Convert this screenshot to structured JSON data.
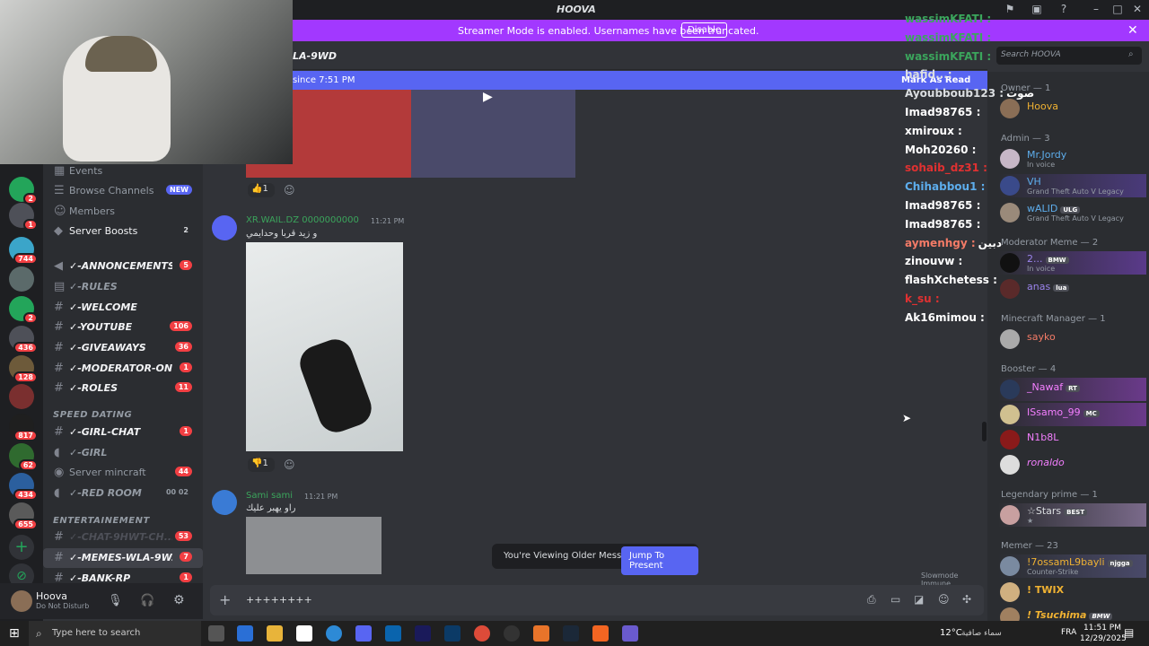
{
  "window": {
    "title": "HOOVA"
  },
  "banner": {
    "text": "Streamer Mode is enabled. Usernames have been truncated.",
    "button": "Disable"
  },
  "channel_header": {
    "name": "LA-9WD",
    "new_since": "since 7:51 PM",
    "mark_read": "Mark As Read"
  },
  "sidebar": {
    "top_items": [
      {
        "label": "Events"
      },
      {
        "label": "Browse Channels",
        "badge": "NEW"
      },
      {
        "label": "Members"
      },
      {
        "label": "Server Boosts",
        "count": "2"
      }
    ],
    "channels": [
      {
        "name": "✓-ANNONCEMENTS...",
        "count": "5",
        "icon": "megaphone-icon"
      },
      {
        "name": "✓-RULES",
        "count": "",
        "icon": "rules-icon"
      },
      {
        "name": "✓-WELCOME",
        "count": "",
        "icon": "hash-icon"
      },
      {
        "name": "✓-YOUTUBE",
        "count": "106",
        "icon": "hash-icon"
      },
      {
        "name": "✓-GIVEAWAYS",
        "count": "36",
        "icon": "hash-icon"
      },
      {
        "name": "✓-MODERATOR-ON...",
        "count": "1",
        "icon": "hash-icon"
      },
      {
        "name": "✓-ROLES",
        "count": "11",
        "icon": "hash-icon"
      }
    ],
    "cat_speed": "SPEED DATING",
    "speed_channels": [
      {
        "name": "✓-GIRL-CHAT",
        "count": "1",
        "icon": "hash-icon"
      },
      {
        "name": "✓-GIRL",
        "count": "",
        "icon": "speaker-icon"
      },
      {
        "name": "Server mincraft",
        "count": "44",
        "icon": "stage-icon"
      },
      {
        "name": "✓-RED ROOM",
        "count": "",
        "extra": "00 02",
        "icon": "speaker-icon"
      }
    ],
    "cat_ent": "ENTERTAINEMENT",
    "ent_channels": [
      {
        "name": "✓-CHAT-9HWT-CH...",
        "count": "53",
        "icon": "hash-icon"
      },
      {
        "name": "✓-MEMES-WLA-9W...",
        "count": "7",
        "icon": "hash-icon"
      },
      {
        "name": "✓-BANK-RP",
        "count": "1",
        "icon": "hash-icon"
      }
    ]
  },
  "user": {
    "name": "Hoova",
    "status": "Do Not Disturb"
  },
  "servers": [
    "2",
    "1",
    "744",
    "",
    "2",
    "436",
    "128",
    "",
    "817",
    "62",
    "434",
    "655"
  ],
  "messages": [
    {
      "reactions": "1"
    },
    {
      "author": "XR.WAIL.DZ 0000000000",
      "time": "11:21 PM",
      "text": "و زيد قربا وحدايمي",
      "reaction": "1"
    },
    {
      "author": "Sami sami",
      "time": "11:21 PM",
      "text": "راو يهبر عليك"
    }
  ],
  "older": {
    "text": "You're Viewing Older Messages",
    "button": "Jump To Present"
  },
  "slowmode": "Slowmode Immune",
  "input": {
    "value": "++++++++"
  },
  "search": {
    "placeholder": "Search HOOVA"
  },
  "members": {
    "groups": [
      {
        "title": "Owner — 1",
        "users": [
          {
            "name": "Hoova",
            "color": "#f0b232",
            "sub": ""
          }
        ]
      },
      {
        "title": "Admin — 3",
        "users": [
          {
            "name": "Mr.Jordy",
            "color": "#5dadec",
            "sub": "In voice"
          },
          {
            "name": "VH",
            "color": "#5dadec",
            "sub": "Grand Theft Auto V Legacy"
          },
          {
            "name": "wALID",
            "tag": "ULG",
            "color": "#5dadec",
            "sub": "Grand Theft Auto V Legacy"
          }
        ]
      },
      {
        "title": "Moderator Meme — 2",
        "users": [
          {
            "name": "2...",
            "tag": "BMW",
            "color": "#9b84ec",
            "sub": "In voice"
          },
          {
            "name": "anas",
            "tag": "lua",
            "color": "#9b84ec",
            "sub": ""
          }
        ]
      },
      {
        "title": "Minecraft Manager — 1",
        "users": [
          {
            "name": "sayko",
            "color": "#f47b67",
            "sub": ""
          }
        ]
      },
      {
        "title": "Booster — 4",
        "users": [
          {
            "name": "_Nawaf",
            "tag": "RT",
            "color": "#f47fff",
            "sub": ""
          },
          {
            "name": "ISsamo_99",
            "tag": "MC",
            "color": "#f47fff",
            "sub": ""
          },
          {
            "name": "N1b8L",
            "color": "#f47fff",
            "sub": ""
          },
          {
            "name": "ronaldo",
            "color": "#f47fff",
            "sub": ""
          }
        ]
      },
      {
        "title": "Legendary prime — 1",
        "users": [
          {
            "name": "☆Stars",
            "tag": "BEST",
            "color": "#dbdee1",
            "sub": "★"
          }
        ]
      },
      {
        "title": "Memer — 23",
        "users": [
          {
            "name": "!7ossamL9bayli",
            "tag": "njgga",
            "color": "#f0b232",
            "sub": "Counter-Strike"
          },
          {
            "name": "! TWIX",
            "color": "#f0b232",
            "sub": ""
          },
          {
            "name": "! Tsuchima",
            "tag": "BMW",
            "color": "#f0b232",
            "sub": ""
          }
        ]
      }
    ]
  },
  "stream_chat": [
    {
      "name": "wassimKFATI :",
      "color": "#3ba55c"
    },
    {
      "name": "wassimKFATI :",
      "color": "#3ba55c"
    },
    {
      "name": "wassimKFATI :",
      "color": "#3ba55c"
    },
    {
      "name": "hafid...:",
      "color": "#dbdee1"
    },
    {
      "name": "Ayoubboub123 :",
      "color": "#dbdee1",
      "extra": "صوت"
    },
    {
      "name": "Imad98765 :",
      "color": "#ffffff"
    },
    {
      "name": "xmiroux :",
      "color": "#ffffff"
    },
    {
      "name": "Moh20260 :",
      "color": "#ffffff"
    },
    {
      "name": "sohaib_dz31 :",
      "color": "#e03131"
    },
    {
      "name": "Chihabbou1 :",
      "color": "#5dadec"
    },
    {
      "name": "Imad98765 :",
      "color": "#ffffff"
    },
    {
      "name": "Imad98765 :",
      "color": "#ffffff"
    },
    {
      "name": "aymenhgy :",
      "color": "#f47b67",
      "extra": "دبين"
    },
    {
      "name": "zinouvw :",
      "color": "#ffffff"
    },
    {
      "name": "flashXchetess :",
      "color": "#ffffff"
    },
    {
      "name": "k_su :",
      "color": "#e03131"
    },
    {
      "name": "Ak16mimou :",
      "color": "#ffffff"
    }
  ],
  "taskbar": {
    "search": "Type here to search",
    "weather": "12°C",
    "weather_text": "سماء صافية",
    "lang": "FRA",
    "time": "11:51 PM",
    "date": "12/29/2025"
  }
}
